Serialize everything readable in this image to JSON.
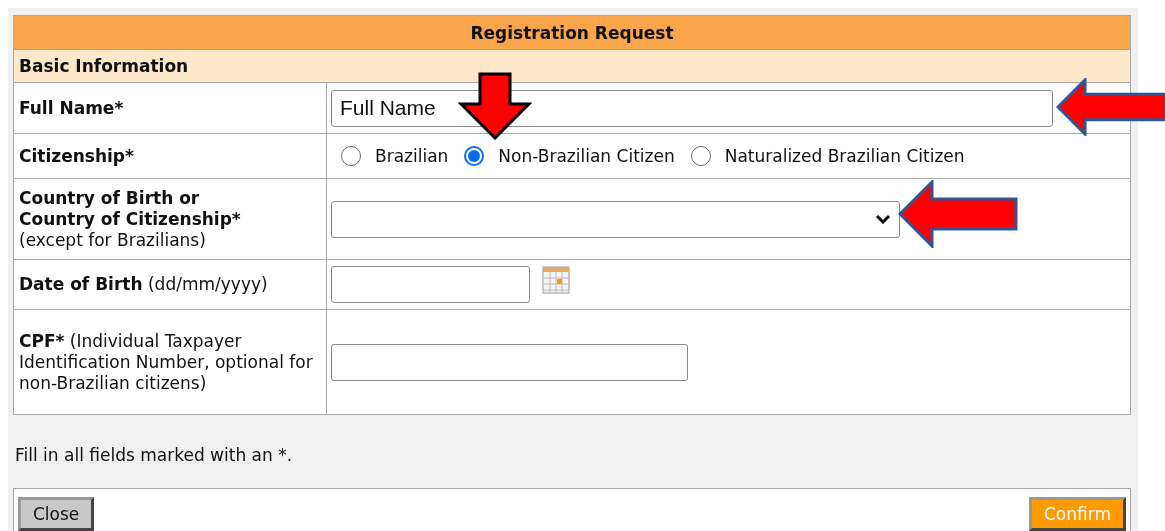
{
  "form": {
    "title": "Registration Request",
    "section": "Basic Information",
    "fields": [
      {
        "kind": "text",
        "label": "Full Name*",
        "value": "Full Name"
      },
      {
        "kind": "radio",
        "label": "Citizenship*",
        "options": [
          {
            "label": "Brazilian",
            "selected": false
          },
          {
            "label": "Non-Brazilian Citizen",
            "selected": true
          },
          {
            "label": "Naturalized Brazilian Citizen",
            "selected": false
          }
        ]
      },
      {
        "kind": "select",
        "label": "Country of Birth or\nCountry of Citizenship*",
        "hint": "(except for Brazilians)"
      },
      {
        "kind": "date",
        "label": "Date of Birth",
        "hint": "(dd/mm/yyyy)"
      },
      {
        "kind": "text",
        "label": "CPF*",
        "hint": "(Individual Taxpayer Identification Number, optional for non-Brazilian citizens)"
      }
    ]
  },
  "note": "Fill in all fields marked with an *.",
  "buttons": [
    {
      "kind": "secondary",
      "label": "Close"
    },
    {
      "kind": "primary",
      "label": "Confirm"
    }
  ]
}
